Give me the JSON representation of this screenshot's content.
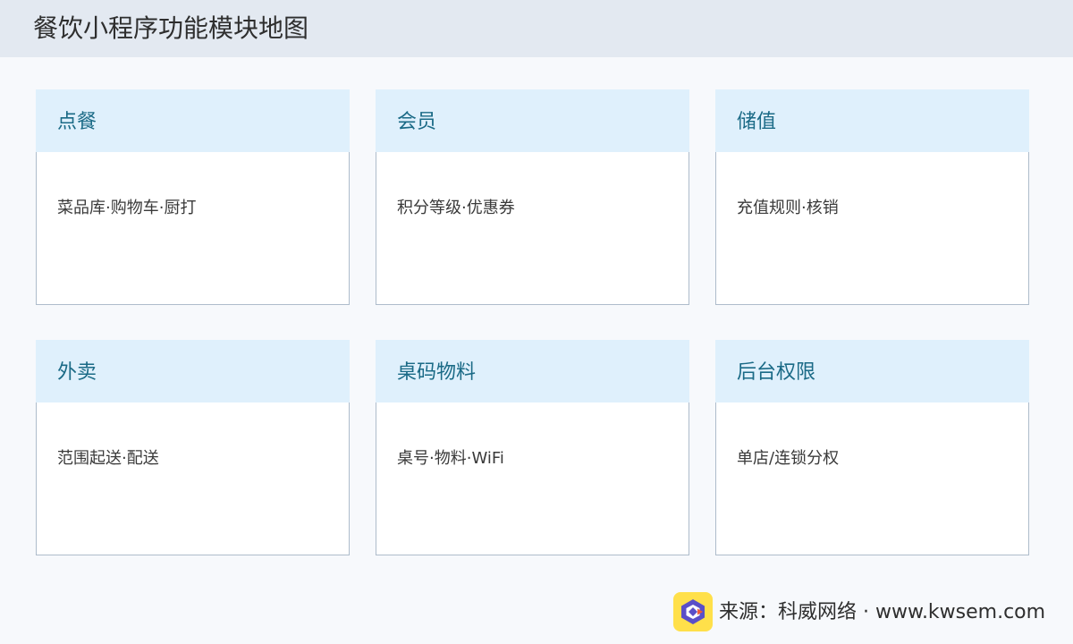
{
  "header": {
    "title": "餐饮小程序功能模块地图"
  },
  "modules": [
    {
      "title": "点餐",
      "desc": "菜品库·购物车·厨打"
    },
    {
      "title": "会员",
      "desc": "积分等级·优惠券"
    },
    {
      "title": "储值",
      "desc": "充值规则·核销"
    },
    {
      "title": "外卖",
      "desc": "范围起送·配送"
    },
    {
      "title": "桌码物料",
      "desc": "桌号·物料·WiFi"
    },
    {
      "title": "后台权限",
      "desc": "单店/连锁分权"
    }
  ],
  "footer": {
    "source": "来源：科威网络 · www.kwsem.com",
    "logo_icon": "kwsem-logo-icon",
    "colors": {
      "logo_bg": "#ffe04a",
      "logo_main": "#5a4fc8",
      "logo_accent": "#f05a3a"
    }
  },
  "colors": {
    "header_bg": "#e3e9f1",
    "card_header_bg": "#dff0fc",
    "card_title": "#1a6a86",
    "card_border": "#aebccb"
  }
}
